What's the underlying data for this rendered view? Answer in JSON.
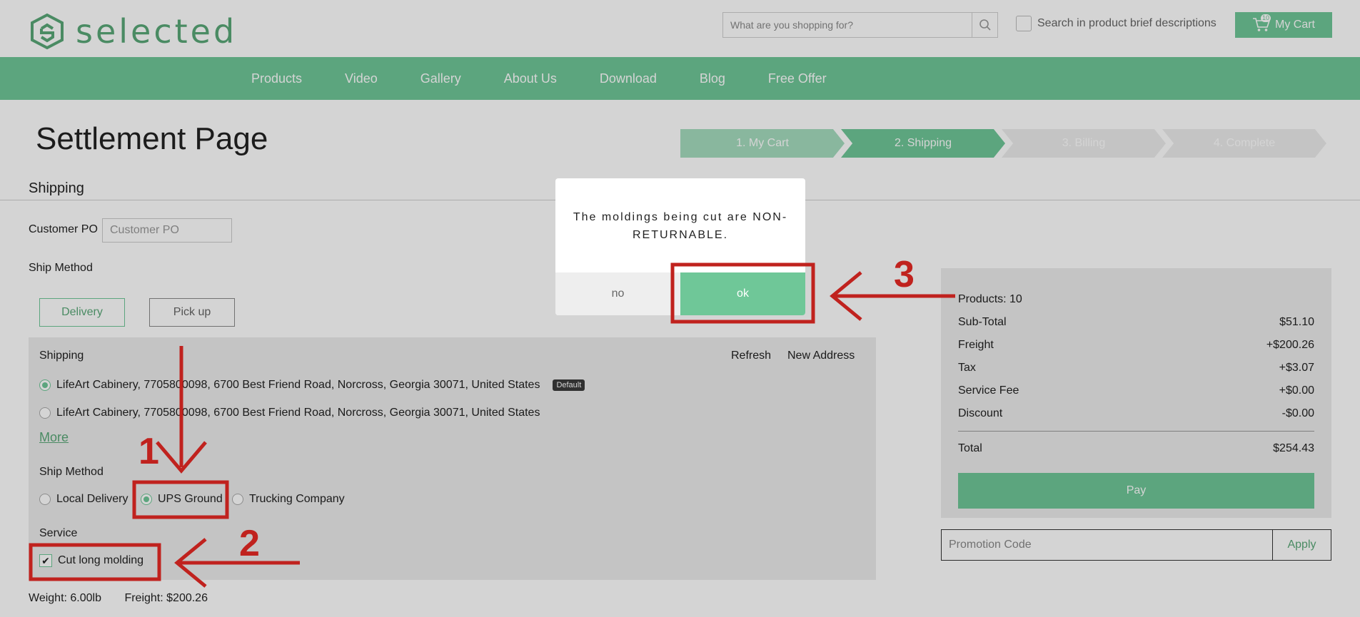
{
  "header": {
    "logo_text": "selected",
    "search_placeholder": "What are you shopping for?",
    "brief_label": "Search in product brief descriptions",
    "cart_label": "My Cart",
    "cart_count": "10"
  },
  "nav": {
    "items": [
      "Products",
      "Video",
      "Gallery",
      "About Us",
      "Download",
      "Blog",
      "Free Offer"
    ]
  },
  "page": {
    "title": "Settlement Page",
    "steps": [
      {
        "label": "1. My Cart",
        "color": "#a5dcbf"
      },
      {
        "label": "2. Shipping",
        "color": "#6fc798"
      },
      {
        "label": "3. Billing",
        "color": "#ececec"
      },
      {
        "label": "4. Complete",
        "color": "#ececec"
      }
    ],
    "section_title": "Shipping",
    "po_label": "Customer PO",
    "po_placeholder": "Customer PO",
    "ship_method_label": "Ship Method",
    "tab_delivery": "Delivery",
    "tab_pickup": "Pick up"
  },
  "shipping_panel": {
    "title": "Shipping",
    "refresh": "Refresh",
    "new_address": "New Address",
    "addresses": [
      {
        "text": "LifeArt Cabinery, 7705800098, 6700 Best Friend Road, Norcross, Georgia 30071, United States",
        "badge": "Default",
        "selected": true
      },
      {
        "text": "LifeArt Cabinery, 7705800098, 6700 Best Friend Road, Norcross, Georgia 30071, United States",
        "selected": false
      }
    ],
    "more": "More",
    "ship_method_label": "Ship Method",
    "methods": [
      {
        "label": "Local Delivery",
        "selected": false
      },
      {
        "label": "UPS Ground",
        "selected": true
      },
      {
        "label": "Trucking Company",
        "selected": false
      }
    ],
    "service_label": "Service",
    "service_option": "Cut long molding",
    "service_checked": true
  },
  "weight_line": "Weight: 6.00lb",
  "freight_line": "Freight: $200.26",
  "summary": {
    "products": "Products: 10",
    "rows": [
      {
        "label": "Sub-Total",
        "value": "$51.10"
      },
      {
        "label": "Freight",
        "value": "+$200.26"
      },
      {
        "label": "Tax",
        "value": "+$3.07"
      },
      {
        "label": "Service Fee",
        "value": "+$0.00"
      },
      {
        "label": "Discount",
        "value": "-$0.00"
      }
    ],
    "total_label": "Total",
    "total_value": "$254.43",
    "pay": "Pay",
    "promo_placeholder": "Promotion Code",
    "apply": "Apply"
  },
  "modal": {
    "message": "The moldings being cut are NON-RETURNABLE.",
    "no": "no",
    "ok": "ok"
  },
  "annotations": {
    "n1": "1",
    "n2": "2",
    "n3": "3",
    "color": "#c0221e"
  },
  "colors": {
    "brand_green": "#6fc798",
    "annotation_red": "#c0221e"
  }
}
